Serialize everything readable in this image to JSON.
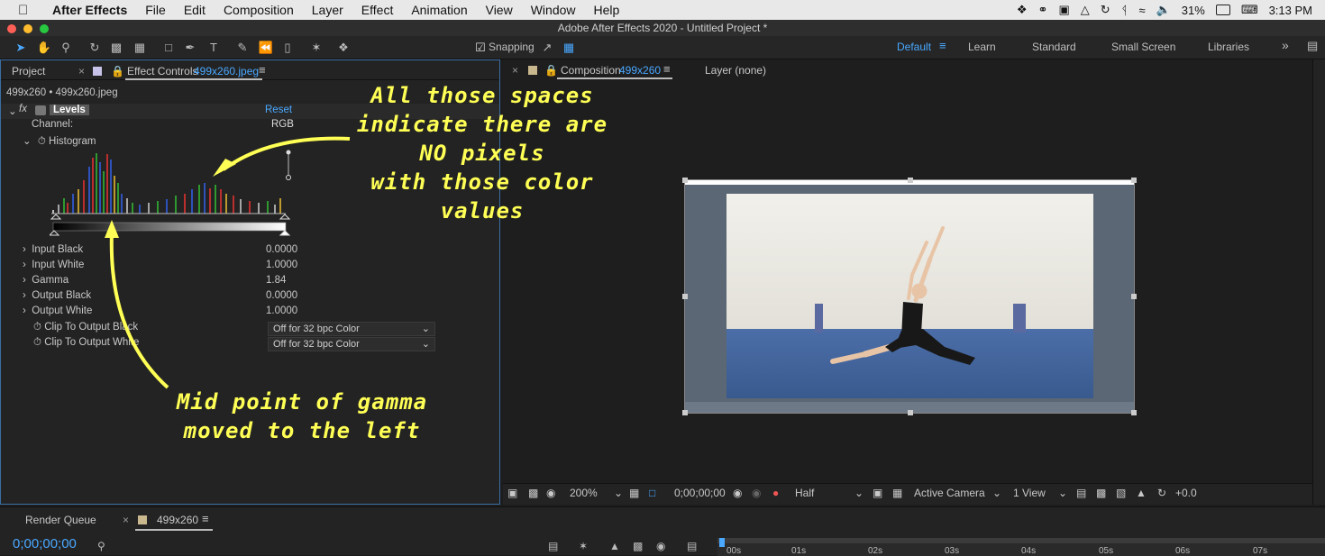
{
  "menubar": {
    "app": "After Effects",
    "items": [
      "File",
      "Edit",
      "Composition",
      "Layer",
      "Effect",
      "Animation",
      "View",
      "Window",
      "Help"
    ],
    "battery": "31%",
    "time": "3:13 PM"
  },
  "window": {
    "title": "Adobe After Effects 2020 - Untitled Project *"
  },
  "toolbar": {
    "snapping": "Snapping",
    "workspaces": [
      "Default",
      "Learn",
      "Standard",
      "Small Screen",
      "Libraries"
    ],
    "active_workspace": "Default"
  },
  "left_panel": {
    "tab_project": "Project",
    "tab_effect_controls": "Effect Controls",
    "tab_effect_file": "499x260.jpeg",
    "breadcrumb": "499x260 • 499x260.jpeg",
    "effect_name": "Levels",
    "reset": "Reset",
    "channel_label": "Channel:",
    "channel_value": "RGB",
    "histogram_label": "Histogram",
    "props": [
      {
        "label": "Input Black",
        "value": "0.0000"
      },
      {
        "label": "Input White",
        "value": "1.0000"
      },
      {
        "label": "Gamma",
        "value": "1.84"
      },
      {
        "label": "Output Black",
        "value": "0.0000"
      },
      {
        "label": "Output White",
        "value": "1.0000"
      }
    ],
    "clip_black_label": "Clip To Output Black",
    "clip_white_label": "Clip To Output White",
    "clip_black_value": "Off for 32 bpc Color",
    "clip_white_value": "Off for 32 bpc Color"
  },
  "comp_panel": {
    "tab_prefix": "Composition",
    "tab_name": "499x260",
    "layer_tab": "Layer (none)",
    "zoom": "200%",
    "timecode": "0;00;00;00",
    "resolution": "Half",
    "camera": "Active Camera",
    "views": "1 View",
    "exposure": "+0.0"
  },
  "timeline": {
    "render_queue": "Render Queue",
    "comp_tab": "499x260",
    "timecode": "0;00;00;00",
    "ruler": [
      "00s",
      "01s",
      "02s",
      "03s",
      "04s",
      "05s",
      "06s",
      "07s"
    ]
  },
  "annotations": {
    "top": "All those spaces\nindicate there are\nNO pixels\nwith those color\nvalues",
    "bottom": "Mid point of gamma\nmoved to the left"
  },
  "colors": {
    "accent": "#4aa8ff",
    "annotation": "#ffff55",
    "panel_bg": "#232323"
  }
}
